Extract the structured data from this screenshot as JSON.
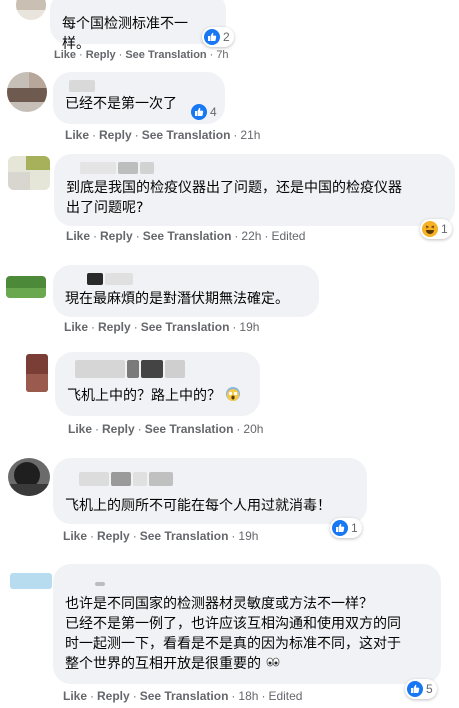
{
  "action_labels": {
    "like": "Like",
    "reply": "Reply",
    "see_translation": "See Translation"
  },
  "comments": [
    {
      "text": "每个国检测标准不一样。",
      "time": "7h",
      "reaction_count": "2",
      "reaction": "like-icon"
    },
    {
      "text": "已经不是第一次了",
      "time": "21h",
      "reaction_count": "4",
      "reaction": "like-icon"
    },
    {
      "text": "到底是我国的检疫仪器出了问题，还是中国的检疫仪器\n出了问题呢?",
      "time": "22h",
      "edited": "Edited",
      "reaction_count": "1",
      "reaction": "haha-icon"
    },
    {
      "text": "現在最麻煩的是對潛伏期無法確定。",
      "time": "19h"
    },
    {
      "text": "飞机上中的？路上中的？",
      "time": "20h",
      "emoji": "face-screaming-icon"
    },
    {
      "text": "飞机上的厕所不可能在每个人用过就消毒！",
      "time": "19h",
      "reaction_count": "1",
      "reaction": "like-icon"
    },
    {
      "text": "也许是不同国家的检测器材灵敏度或方法不一样？\n已经不是第一例了，也许应该互相沟通和使用双方的同\n时一起测一下，看看是不是真的因为标准不同，这对于\n整个世界的互相开放是很重要的",
      "time": "18h",
      "edited": "Edited",
      "reaction_count": "5",
      "reaction": "like-icon",
      "emoji": "eyes-icon"
    }
  ],
  "colors": {
    "bubble": "#f0f2f5",
    "action_text": "#65676b",
    "like_blue": "#1877f2",
    "text": "#050505"
  }
}
